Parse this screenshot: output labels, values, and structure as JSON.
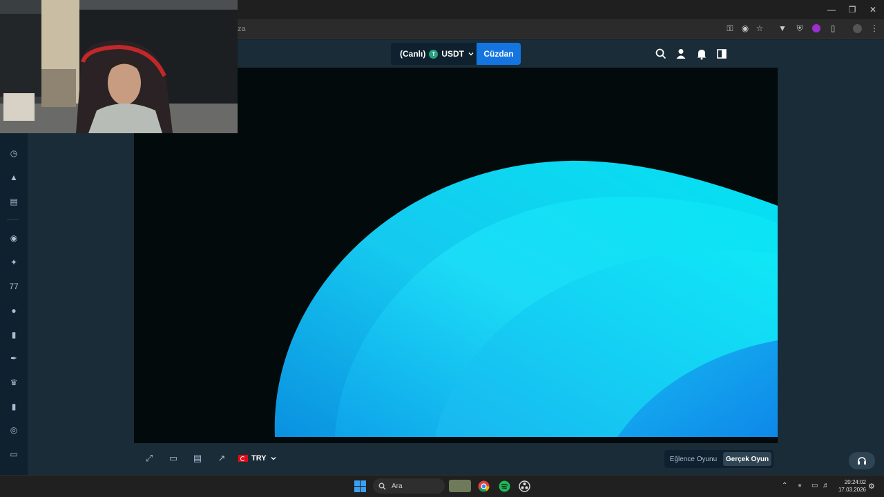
{
  "browser": {
    "omnibox_text": "za"
  },
  "header": {
    "balance_label": "(Canlı)",
    "currency": "USDT",
    "coin_letter": "T",
    "wallet_label": "Cüzdan"
  },
  "footer": {
    "currency": "TRY",
    "fun_mode_label": "Eğlence Oyunu",
    "real_mode_label": "Gerçek Oyun"
  },
  "taskbar": {
    "search_label": "Ara",
    "time": "20:24:02",
    "date": "17.03.2026"
  },
  "colors": {
    "accent": "#1475e1",
    "bg_dark": "#0f212e",
    "bg_panel": "#1a2c38",
    "game_cyan": "#00e5f0"
  }
}
